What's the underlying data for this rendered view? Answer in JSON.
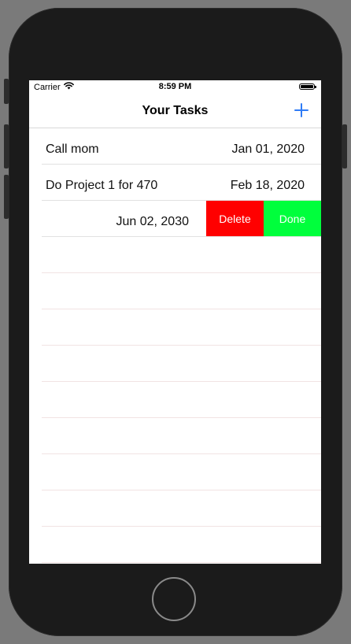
{
  "status_bar": {
    "carrier": "Carrier",
    "time": "8:59 PM",
    "wifi_icon": "wifi-icon",
    "battery_icon": "battery-icon"
  },
  "nav": {
    "title": "Your Tasks",
    "add_icon": "plus-icon",
    "accent_color": "#2f7cf6"
  },
  "tasks": [
    {
      "name": "Call mom",
      "date": "Jan 01, 2020"
    },
    {
      "name": "Do Project 1 for 470",
      "date": "Feb 18, 2020"
    },
    {
      "name": "",
      "date": "Jun 02, 2030"
    }
  ],
  "swipe_actions": {
    "delete_label": "Delete",
    "done_label": "Done",
    "delete_color": "#ff0000",
    "done_color": "#00ff3c"
  }
}
